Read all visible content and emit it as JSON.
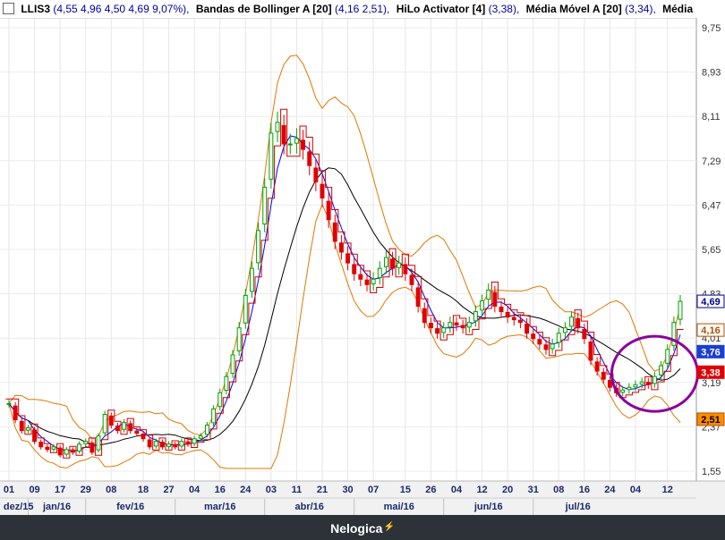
{
  "legend": {
    "symbol": "LLIS3",
    "symbol_values": "(4,55  4,96  4,50  4,69  9,07%),",
    "ind1_name": "Bandas de Bollinger A [20]",
    "ind1_values": "(4,16  2,51),",
    "ind2_name": "HiLo Activator [4]",
    "ind2_values": "(3,38),",
    "ind3_name": "Média Móvel A [20]",
    "ind3_values": "(3,34),",
    "ind4_name": "Média M"
  },
  "brand": {
    "name": "Nelogica"
  },
  "colors": {
    "up": "#00a000",
    "down": "#e00000",
    "bollinger": "#e07800",
    "ma_fast": "#0000ff",
    "ma_slow": "#000000",
    "circle": "#8b009b"
  },
  "chart_data": {
    "type": "candlestick",
    "symbol": "LLIS3",
    "y_ticks": [
      "9,75",
      "8,93",
      "8,11",
      "7,29",
      "6,47",
      "5,65",
      "4,83",
      "4,01",
      "3,19",
      "2,37",
      "1,55"
    ],
    "ylim": [
      1.55,
      9.75
    ],
    "day_labels": [
      "01",
      "09",
      "17",
      "29",
      "08",
      "18",
      "27",
      "04",
      "16",
      "24",
      "03",
      "11",
      "21",
      "30",
      "07",
      "15",
      "26",
      "04",
      "12",
      "20",
      "31",
      "08",
      "16",
      "24",
      "04",
      "12"
    ],
    "month_labels": [
      "dez/15",
      "jan/16",
      "fev/16",
      "mar/16",
      "abr/16",
      "mai/16",
      "jun/16",
      "jul/16"
    ],
    "price_tags": [
      {
        "label": "4,69",
        "value": 4.69,
        "color": "#ffffff",
        "text": "#00008b",
        "border": "#00008b"
      },
      {
        "label": "4,16",
        "value": 4.16,
        "color": "#ffffff",
        "text": "#b05000",
        "border": "#b05000"
      },
      {
        "label": "3,76",
        "value": 3.76,
        "color": "#1a3fd1",
        "text": "#ffffff",
        "border": "#1a3fd1"
      },
      {
        "label": "3,38",
        "value": 3.38,
        "color": "#e00000",
        "text": "#ffffff",
        "border": "#e00000"
      },
      {
        "label": "2,51",
        "value": 2.51,
        "color": "#ff8c00",
        "text": "#000000",
        "border": "#b05000"
      }
    ],
    "last_candle": {
      "open": 4.55,
      "high": 4.96,
      "low": 4.5,
      "close": 4.69,
      "change": "9,07%"
    },
    "closes": [
      2.8,
      2.5,
      2.3,
      2.35,
      2.1,
      2.0,
      1.95,
      2.0,
      1.85,
      1.95,
      1.9,
      2.05,
      2.1,
      1.9,
      2.2,
      2.6,
      2.4,
      2.3,
      2.45,
      2.3,
      2.25,
      2.15,
      2.0,
      2.1,
      2.0,
      2.05,
      2.0,
      2.1,
      2.05,
      2.15,
      2.2,
      2.4,
      2.7,
      3.0,
      3.3,
      3.7,
      4.2,
      4.8,
      5.3,
      6.0,
      6.8,
      7.8,
      8.0,
      7.6,
      7.6,
      7.7,
      7.5,
      7.2,
      6.9,
      6.6,
      6.2,
      5.8,
      5.6,
      5.4,
      5.2,
      5.1,
      5.0,
      5.1,
      5.3,
      5.5,
      5.3,
      5.4,
      5.2,
      5.0,
      4.6,
      4.3,
      4.2,
      4.1,
      4.2,
      4.3,
      4.25,
      4.2,
      4.3,
      4.5,
      4.7,
      4.9,
      4.6,
      4.5,
      4.4,
      4.35,
      4.3,
      4.1,
      4.0,
      3.9,
      3.8,
      3.9,
      4.1,
      4.2,
      4.4,
      4.2,
      4.0,
      3.6,
      3.4,
      3.25,
      3.1,
      3.0,
      3.05,
      3.1,
      3.15,
      3.2,
      3.15,
      3.3,
      3.5,
      3.8,
      4.3,
      4.69
    ]
  }
}
